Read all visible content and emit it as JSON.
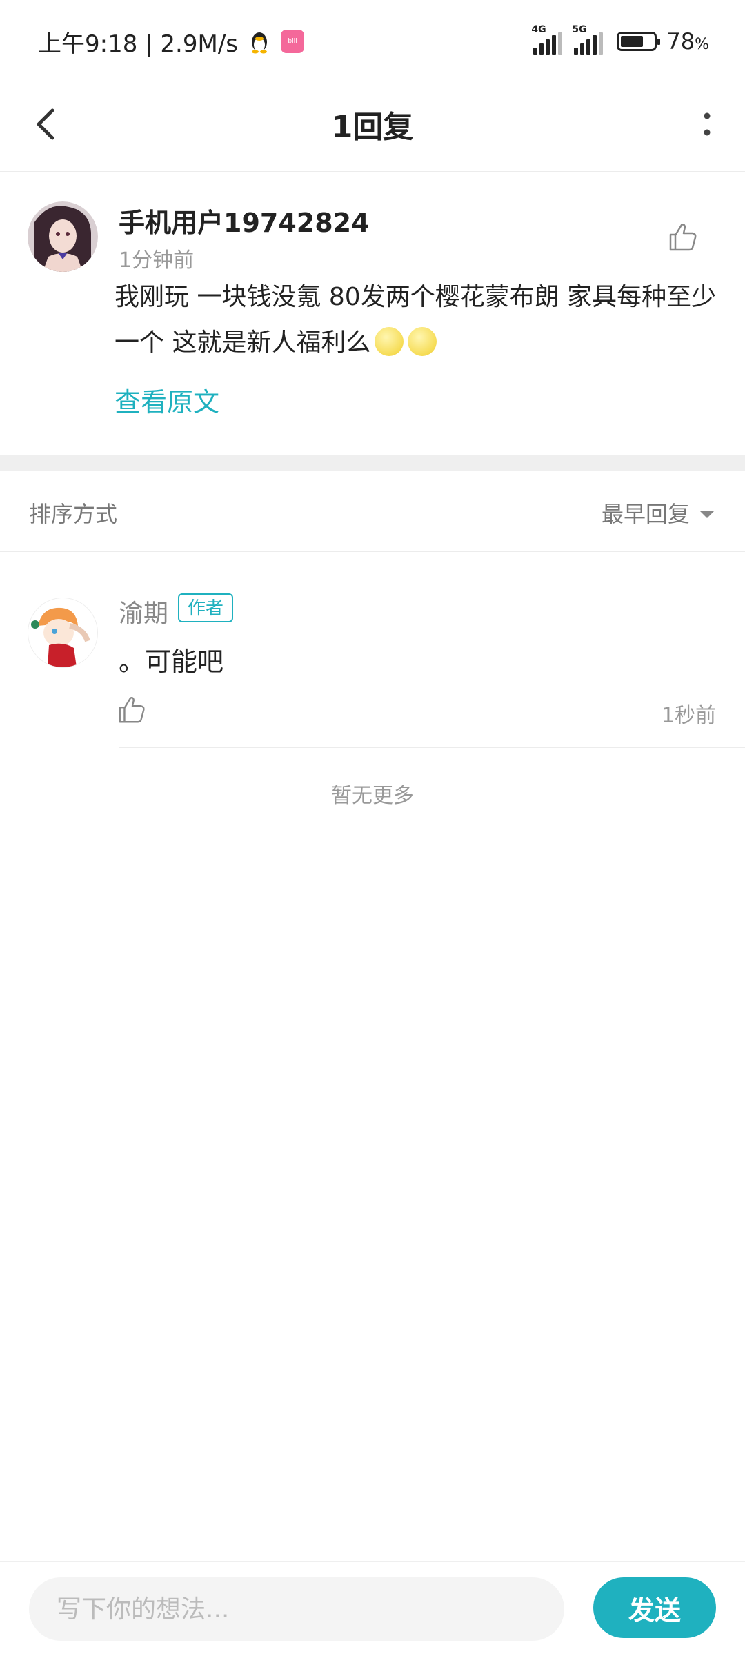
{
  "status_bar": {
    "time_speed": "上午9:18 | 2.9M/s",
    "badge_text": "bili",
    "net1": "4G",
    "net2": "5G",
    "battery_level": 0.78,
    "battery_percent": "78",
    "battery_unit": "%"
  },
  "header": {
    "title": "1回复"
  },
  "original_comment": {
    "username": "手机用户19742824",
    "time": "1分钟前",
    "text": "我刚玩 一块钱没氪 80发两个樱花蒙布朗 家具每种至少一个 这就是新人福利么",
    "view_original": "查看原文"
  },
  "sort": {
    "label": "排序方式",
    "selected": "最早回复"
  },
  "replies": [
    {
      "username": "渝期",
      "tag": "作者",
      "text": "。可能吧",
      "time": "1秒前"
    }
  ],
  "no_more": "暂无更多",
  "composer": {
    "placeholder": "写下你的想法...",
    "send_label": "发送"
  },
  "colors": {
    "accent": "#1fb1bf",
    "muted_text": "#999999",
    "divider": "#efefef"
  }
}
